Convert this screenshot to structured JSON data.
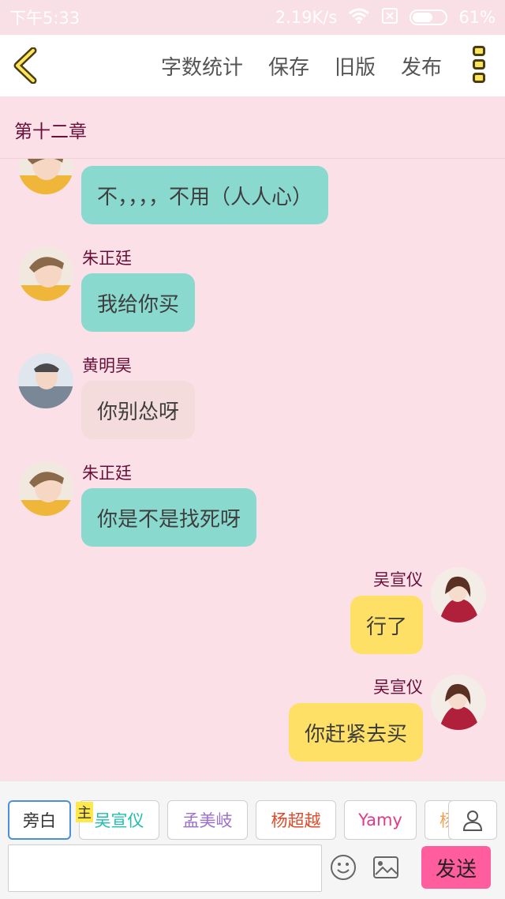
{
  "status_bar": {
    "time": "下午5:33",
    "network_speed": "2.19K/s",
    "battery": "61%",
    "battery_level": 0.61
  },
  "toolbar": {
    "actions": [
      "字数统计",
      "保存",
      "旧版",
      "发布"
    ]
  },
  "chapter": {
    "title": "第十二章"
  },
  "messages": [
    {
      "speaker": "",
      "text": "不，，，，不用（人人心）",
      "side": "left",
      "color": "teal"
    },
    {
      "speaker": "朱正廷",
      "text": "我给你买",
      "side": "left",
      "color": "teal"
    },
    {
      "speaker": "黄明昊",
      "text": "你别怂呀",
      "side": "left",
      "color": "pink"
    },
    {
      "speaker": "朱正廷",
      "text": "你是不是找死呀",
      "side": "left",
      "color": "teal"
    },
    {
      "speaker": "吴宣仪",
      "text": "行了",
      "side": "right",
      "color": "yellow"
    },
    {
      "speaker": "吴宣仪",
      "text": "你赶紧去买",
      "side": "right",
      "color": "yellow"
    }
  ],
  "characters": {
    "host_tag": "主",
    "chips": [
      {
        "label": "旁白",
        "color": "#333333"
      },
      {
        "label": "吴宣仪",
        "color": "#1fbfae"
      },
      {
        "label": "孟美岐",
        "color": "#9b6fd0"
      },
      {
        "label": "杨超越",
        "color": "#e04a2a"
      },
      {
        "label": "Yamy",
        "color": "#e03a8a"
      },
      {
        "label": "杨",
        "color": "#f0a050"
      }
    ]
  },
  "composer": {
    "input_value": "",
    "send_label": "发送"
  },
  "colors": {
    "background": "#fbe0e8",
    "bubble_teal": "#8ad9cf",
    "bubble_pink": "#f5dcdc",
    "bubble_yellow": "#ffe066",
    "speaker_name": "#6a0f3a",
    "send_button": "#ff5d9e"
  }
}
